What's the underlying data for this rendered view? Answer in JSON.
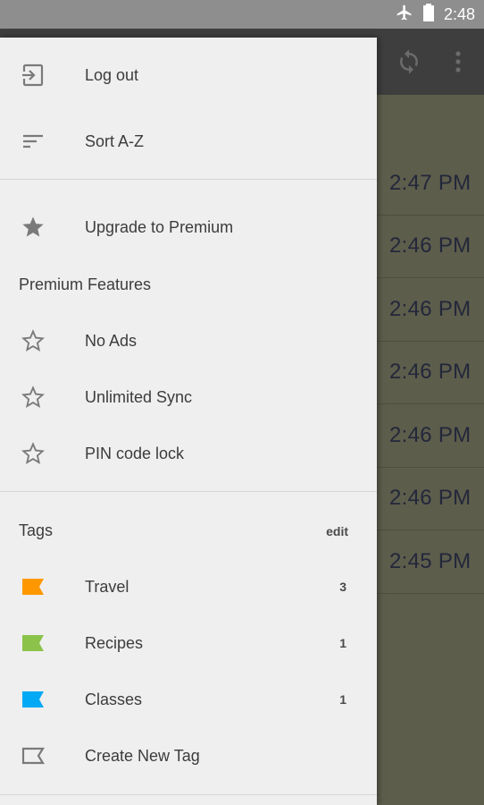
{
  "status": {
    "time": "2:48",
    "icons": [
      "airplane-icon",
      "battery-icon"
    ]
  },
  "toolbar": {
    "icons": [
      "sync-icon",
      "more-vert-icon"
    ]
  },
  "notes_times": [
    "2:47 PM",
    "2:46 PM",
    "2:46 PM",
    "2:46 PM",
    "2:46 PM",
    "2:46 PM",
    "2:45 PM"
  ],
  "drawer": {
    "logout_label": "Log out",
    "sort_label": "Sort A-Z",
    "upgrade_label": "Upgrade to Premium",
    "premium_title": "Premium Features",
    "premium_features": [
      "No Ads",
      "Unlimited Sync",
      "PIN code lock"
    ],
    "tags_title": "Tags",
    "edit_label": "edit",
    "tags": [
      {
        "name": "Travel",
        "count": "3",
        "color": "#ff9800"
      },
      {
        "name": "Recipes",
        "count": "1",
        "color": "#8bc34a"
      },
      {
        "name": "Classes",
        "count": "1",
        "color": "#03a9f4"
      }
    ],
    "create_tag_label": "Create New Tag"
  },
  "colors": {
    "drawer_bg": "#efefef",
    "overlay": "#5d5d4c",
    "appbar": "#3e3e3e",
    "icon_gray": "#7a7a7a"
  }
}
